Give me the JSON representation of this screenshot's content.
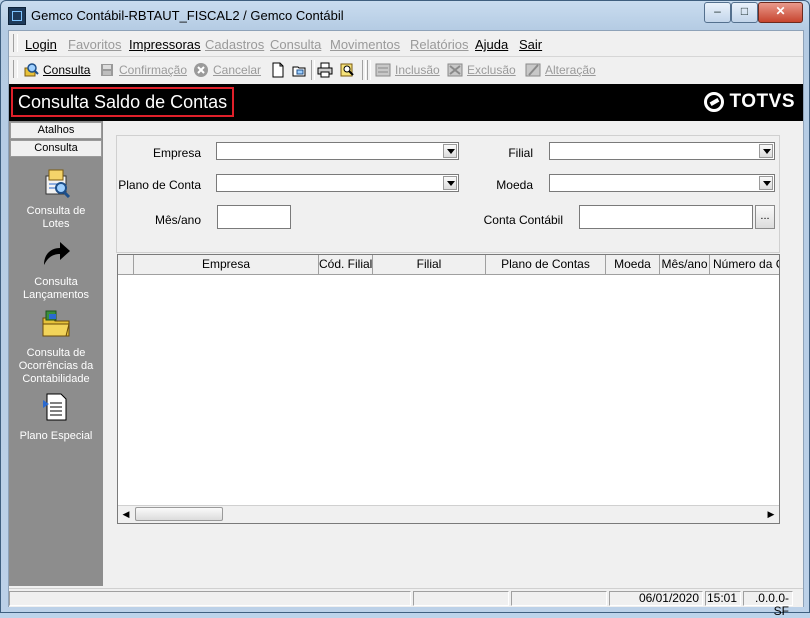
{
  "window": {
    "title": "Gemco Contábil-RBTAUT_FISCAL2 / Gemco Contábil",
    "min": "–",
    "max": "□",
    "close": "✕"
  },
  "menu": {
    "items": [
      {
        "label": "Login",
        "enabled": true
      },
      {
        "label": "Favoritos",
        "enabled": false
      },
      {
        "label": "Impressoras",
        "enabled": true
      },
      {
        "label": "Cadastros",
        "enabled": false
      },
      {
        "label": "Consulta",
        "enabled": false
      },
      {
        "label": "Movimentos",
        "enabled": false
      },
      {
        "label": "Relatórios",
        "enabled": false
      },
      {
        "label": "Ajuda",
        "enabled": true
      },
      {
        "label": "Sair",
        "enabled": true
      }
    ]
  },
  "toolbar": {
    "consulta": "Consulta",
    "confirmacao": "Confirmação",
    "cancelar": "Cancelar",
    "inclusao": "Inclusão",
    "exclusao": "Exclusão",
    "alteracao": "Alteração"
  },
  "banner": {
    "title": "Consulta Saldo de Contas",
    "logo": "TOTVS"
  },
  "sidebar": {
    "tabs": [
      "Atalhos",
      "Consulta"
    ],
    "entries": [
      {
        "label": "Consulta de Lotes",
        "icon": "lotes-icon"
      },
      {
        "label": "Consulta Lançamentos",
        "icon": "arrow-icon"
      },
      {
        "label": "Consulta de Ocorrências da Contabilidade",
        "icon": "folder-icon"
      },
      {
        "label": "Plano Especial",
        "icon": "document-icon"
      }
    ]
  },
  "filters": {
    "empresa_label": "Empresa",
    "empresa_value": "",
    "filial_label": "Filial",
    "filial_value": "",
    "plano_label": "Plano de Conta",
    "plano_value": "",
    "moeda_label": "Moeda",
    "moeda_value": "",
    "mesano_label": "Mês/ano",
    "mesano_value": "",
    "conta_label": "Conta Contábil",
    "conta_value": "",
    "ellipsis": "..."
  },
  "grid": {
    "columns": [
      "",
      "Empresa",
      "Cód. Filial",
      "Filial",
      "Plano de Contas",
      "Moeda",
      "Mês/ano",
      "Número da Co"
    ],
    "rows": []
  },
  "status": {
    "date": "06/01/2020",
    "time": "15:01",
    "version": ".0.0.0-SF"
  }
}
